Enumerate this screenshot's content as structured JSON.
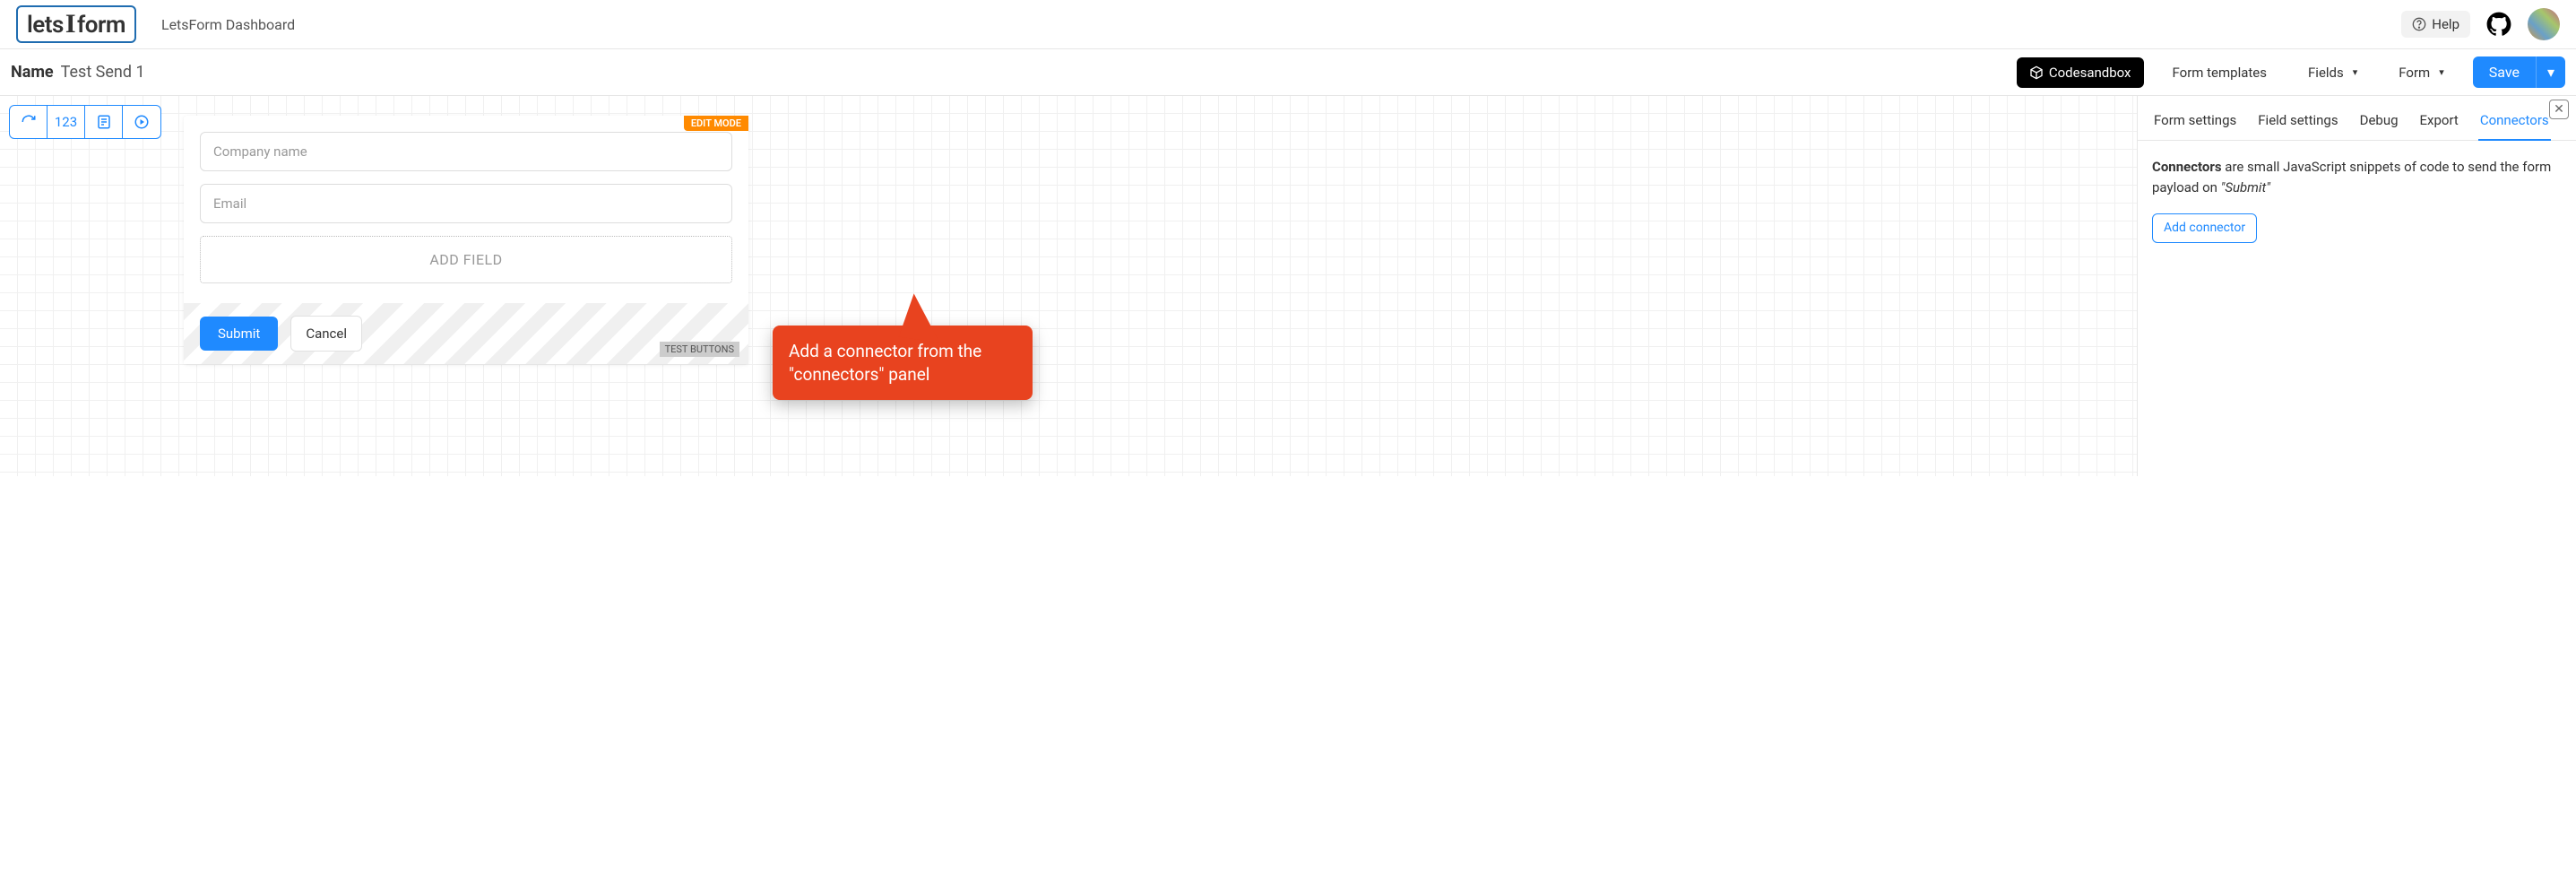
{
  "header": {
    "logo_parts": {
      "left": "lets",
      "mid": "I",
      "right": "form"
    },
    "dashboard_title": "LetsForm Dashboard",
    "help_label": "Help"
  },
  "toolbar": {
    "name_label": "Name",
    "name_value": "Test Send 1",
    "codesandbox_label": "Codesandbox",
    "form_templates_label": "Form templates",
    "fields_label": "Fields",
    "form_label": "Form",
    "save_label": "Save"
  },
  "left_toolbar_icons": [
    "refresh",
    "123",
    "form",
    "play"
  ],
  "form_card": {
    "edit_mode_badge": "EDIT MODE",
    "inputs": [
      {
        "placeholder": "Company name"
      },
      {
        "placeholder": "Email"
      }
    ],
    "add_field_label": "ADD FIELD",
    "submit_label": "Submit",
    "cancel_label": "Cancel",
    "test_buttons_badge": "TEST BUTTONS"
  },
  "side_panel": {
    "tabs": [
      "Form settings",
      "Field settings",
      "Debug",
      "Export",
      "Connectors"
    ],
    "active_tab_index": 4,
    "desc_bold": "Connectors",
    "desc_rest_1": " are small JavaScript snippets of code to send the form payload on ",
    "desc_italic": "\"Submit\"",
    "add_connector_label": "Add connector"
  },
  "callout": {
    "text": "Add a connector from the \"connectors\" panel"
  },
  "colors": {
    "accent": "#1f8aff",
    "orange": "#ff8a00",
    "callout": "#e8431f"
  }
}
